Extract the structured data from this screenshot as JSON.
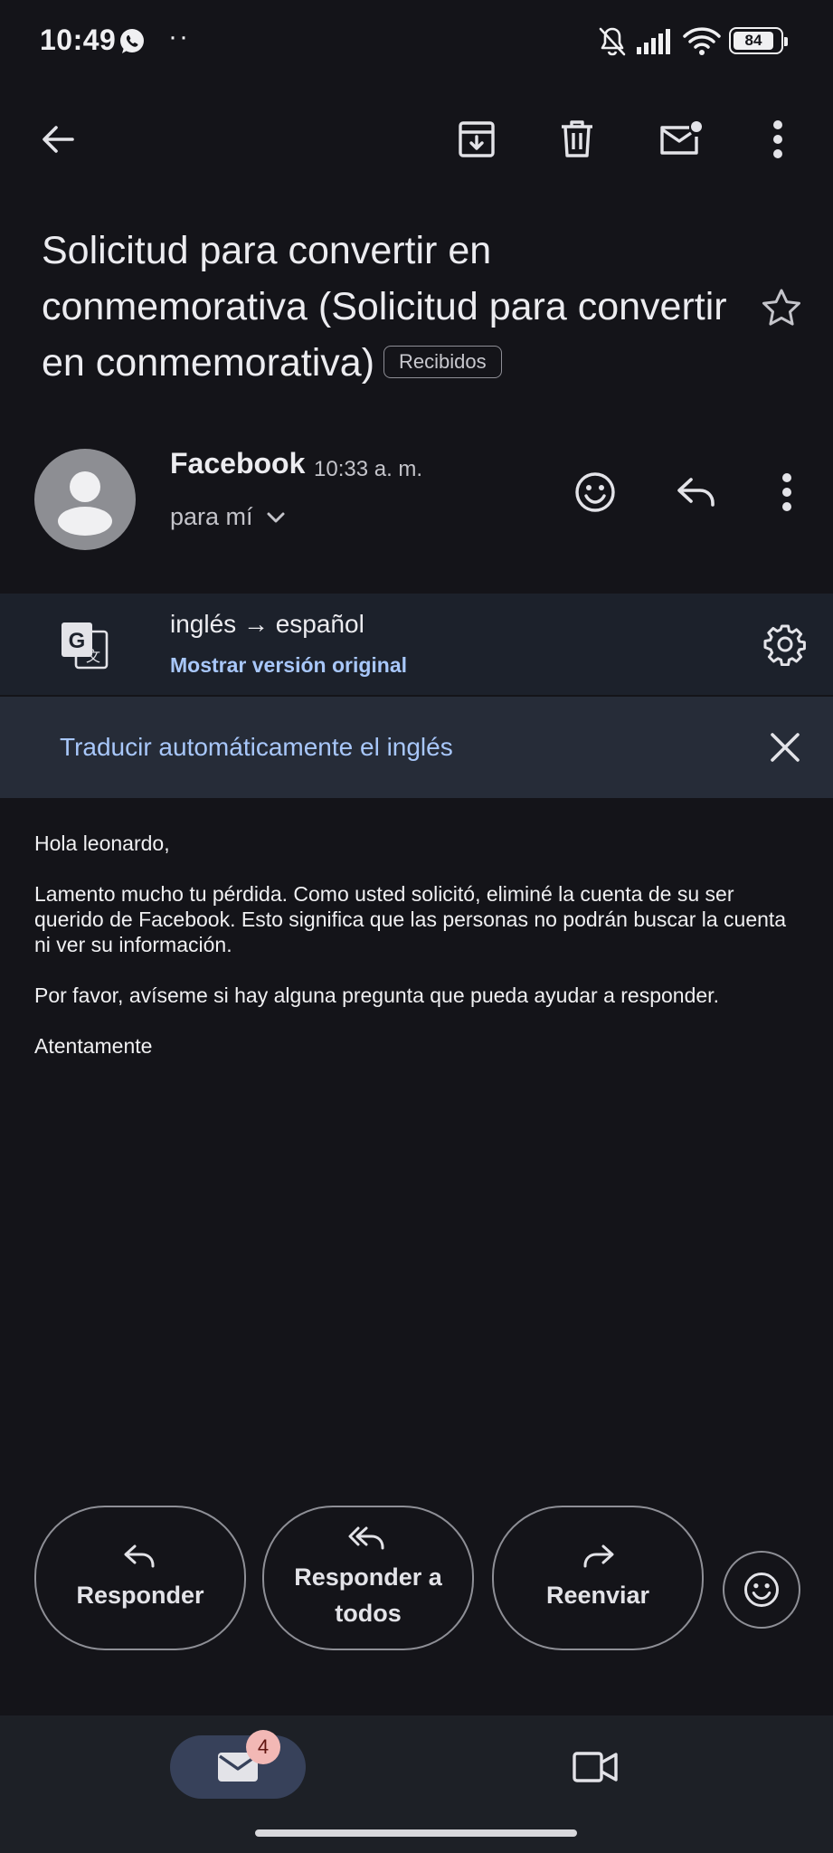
{
  "status_bar": {
    "time": "10:49",
    "dots": "··",
    "battery": "84"
  },
  "toolbar": {
    "icons": [
      "back-arrow-icon",
      "archive-icon",
      "delete-icon",
      "mark-unread-icon",
      "more-vert-icon"
    ]
  },
  "email": {
    "subject": "Solicitud para convertir en conmemorativa (Solicitud para convertir en conmemorativa)",
    "label": "Recibidos",
    "sender": "Facebook",
    "time": "10:33 a. m.",
    "recipient": "para mí"
  },
  "translation": {
    "languages": "inglés → español",
    "show_original": "Mostrar versión original",
    "auto_translate": "Traducir automáticamente el inglés"
  },
  "body": {
    "greeting": "Hola leonardo,",
    "paragraph1": "Lamento mucho tu pérdida. Como usted solicitó, eliminé la cuenta de su ser querido de Facebook. Esto significa que las personas no podrán buscar la cuenta ni ver su información.",
    "paragraph2": "Por favor, avíseme si hay alguna pregunta que pueda ayudar a responder.",
    "closing": "Atentamente"
  },
  "actions": {
    "reply": "Responder",
    "reply_all": "Responder a todos",
    "forward": "Reenviar"
  },
  "bottom_nav": {
    "mail_badge": "4"
  },
  "colors": {
    "background": "#141419",
    "accent_link": "#a8c7fa",
    "translate_panel": "#1c212b",
    "auto_translate_bar": "#262c38",
    "badge": "#f2b8b5"
  }
}
